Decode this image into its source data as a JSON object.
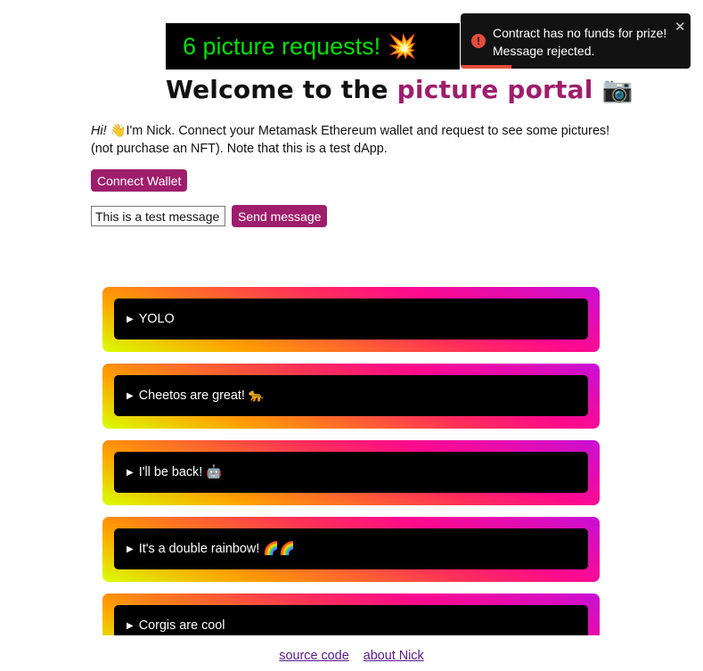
{
  "banner": {
    "counter_text": "6 picture requests! 💥"
  },
  "header": {
    "title_prefix": "Welcome to the ",
    "title_accent": "picture portal",
    "title_emoji": "📷"
  },
  "intro": {
    "greeting": "Hi!",
    "wave_emoji": "👋",
    "text": "I'm Nick. Connect your Metamask Ethereum wallet and request to see some pictures! (not purchase an NFT). Note that this is a test dApp."
  },
  "actions": {
    "connect_label": "Connect Wallet",
    "message_value": "This is a test message",
    "send_label": "Send message"
  },
  "feed": {
    "items": [
      {
        "label": "YOLO"
      },
      {
        "label": "Cheetos are great! 🐆"
      },
      {
        "label": "I'll be back! 🤖"
      },
      {
        "label": "It's a double rainbow! 🌈🌈"
      },
      {
        "label": "Corgis are cool"
      }
    ]
  },
  "footer": {
    "source_label": "source code",
    "about_label": "about Nick"
  },
  "toast": {
    "line1": "Contract has no funds for prize!",
    "line2": "Message rejected.",
    "icon": "error-icon",
    "close_glyph": "✕",
    "progress_remaining": 0.22
  },
  "colors": {
    "accent": "#9e1e6b",
    "counter_text": "#00e000",
    "error": "#e74c3c"
  }
}
